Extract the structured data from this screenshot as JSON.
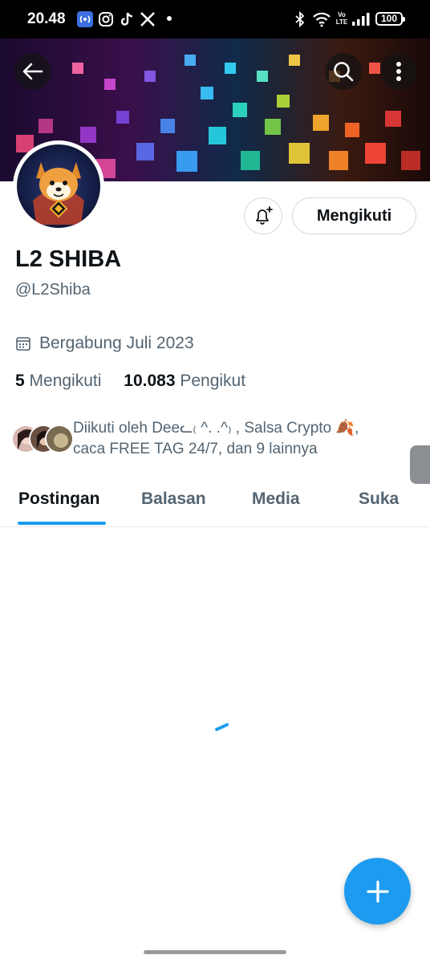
{
  "status_bar": {
    "time": "20.48",
    "battery": "100",
    "network_label_top": "Vo",
    "network_label_bottom": "LTE",
    "icons": [
      "broadcast-icon",
      "instagram-icon",
      "tiktok-icon",
      "x-icon",
      "bluetooth-icon",
      "wifi-icon",
      "signal-icon",
      "battery-icon"
    ]
  },
  "profile": {
    "name": "L2 SHIBA",
    "handle": "@L2Shiba",
    "joined": "Bergabung Juli 2023",
    "following_count": "5",
    "following_label": "Mengikuti",
    "followers_count": "10.083",
    "followers_label": "Pengikut",
    "followed_by": "Diikuti oleh Deeᓚ₍ ^. .^₎ , Salsa Crypto 🍂, caca FREE TAG 24/7, dan 9 lainnya"
  },
  "actions": {
    "follow_label": "Mengikuti"
  },
  "tabs": [
    {
      "label": "Postingan",
      "active": true
    },
    {
      "label": "Balasan",
      "active": false
    },
    {
      "label": "Media",
      "active": false
    },
    {
      "label": "Suka",
      "active": false
    }
  ],
  "colors": {
    "accent": "#1d9bf0",
    "text_primary": "#0f1419",
    "text_secondary": "#536471",
    "border": "#cfd9de"
  }
}
